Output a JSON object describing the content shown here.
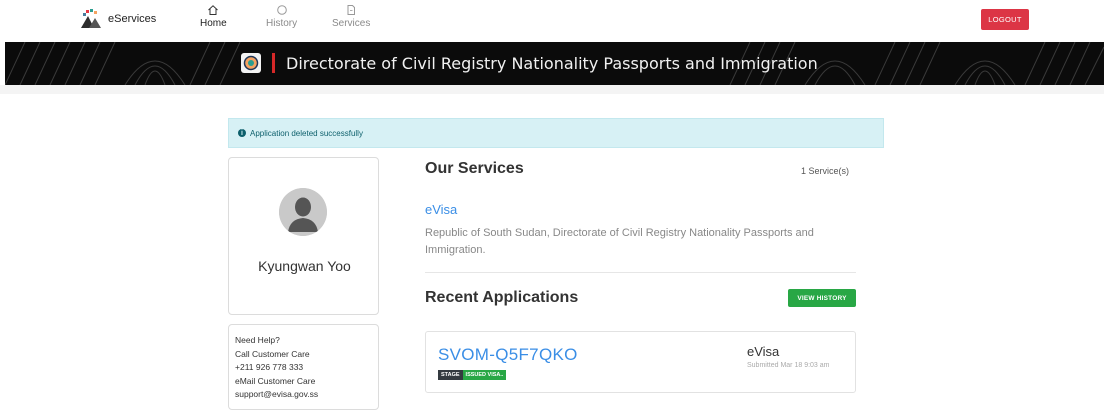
{
  "nav": {
    "brand": "eServices",
    "items": [
      {
        "label": "Home",
        "icon": "home-icon"
      },
      {
        "label": "History",
        "icon": "history-icon"
      },
      {
        "label": "Services",
        "icon": "document-icon"
      }
    ],
    "logout": "LOGOUT"
  },
  "banner": {
    "title": "Directorate of Civil Registry Nationality Passports and Immigration"
  },
  "alert": {
    "message": "Application deleted successfully"
  },
  "profile": {
    "name": "Kyungwan Yoo"
  },
  "help": {
    "heading": "Need Help?",
    "call_label": "Call Customer Care",
    "phone": "+211 926 778 333",
    "email_label": "eMail Customer Care",
    "email": "support@evisa.gov.ss"
  },
  "services": {
    "heading": "Our Services",
    "count": "1 Service(s)",
    "items": [
      {
        "name": "eVisa",
        "description": "Republic of South Sudan, Directorate of Civil Registry Nationality Passports and Immigration."
      }
    ]
  },
  "recent": {
    "heading": "Recent Applications",
    "view_history": "VIEW HISTORY",
    "applications": [
      {
        "id": "SVOM-Q5F7QKO",
        "stage_label": "STAGE",
        "status": "ISSUED VISA..",
        "service": "eVisa",
        "submitted": "Submitted Mar 18 9:03 am"
      }
    ]
  },
  "colors": {
    "danger": "#dc3545",
    "success": "#28a745",
    "link": "#3a8ee6",
    "info_bg": "#d7f1f5",
    "banner_bg": "#0b0b0b",
    "accent_red": "#d62828"
  }
}
